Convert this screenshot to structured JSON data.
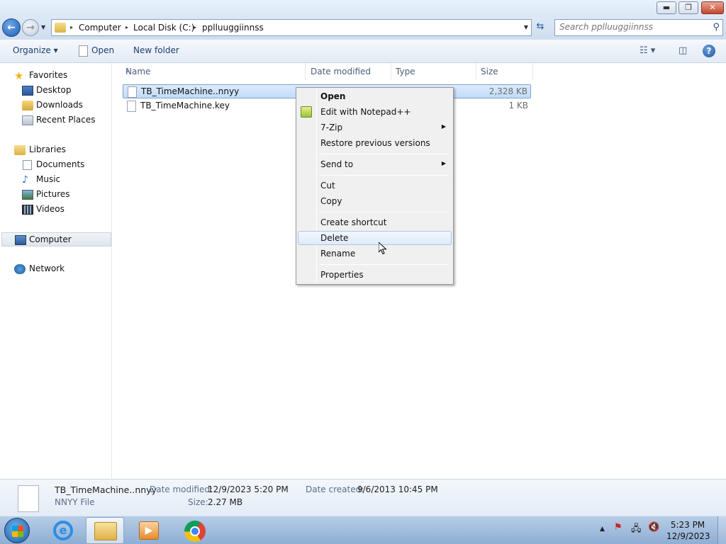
{
  "window": {
    "min_glyph": "▬",
    "max_glyph": "❐",
    "close_glyph": "✕"
  },
  "address": {
    "crumbs": [
      "Computer",
      "Local Disk (C:)",
      "pplluuggiinnss"
    ],
    "separator": "▸"
  },
  "search": {
    "placeholder": "Search pplluuggiinnss"
  },
  "toolbar": {
    "organize": "Organize ▾",
    "open": "Open",
    "new_folder": "New folder",
    "views_glyph": "☷ ▾",
    "preview_glyph": "◫",
    "help": "?"
  },
  "navpane": {
    "favorites": "Favorites",
    "desktop": "Desktop",
    "downloads": "Downloads",
    "recent": "Recent Places",
    "libraries": "Libraries",
    "documents": "Documents",
    "music": "Music",
    "pictures": "Pictures",
    "videos": "Videos",
    "computer": "Computer",
    "network": "Network"
  },
  "columns": {
    "name": "Name",
    "date_modified": "Date modified",
    "type": "Type",
    "size": "Size"
  },
  "files": [
    {
      "name": "TB_TimeMachine..nnyy",
      "size": "2,328 KB"
    },
    {
      "name": "TB_TimeMachine.key",
      "size": "1 KB"
    }
  ],
  "context_menu": {
    "open": "Open",
    "edit_npp": "Edit with Notepad++",
    "zip": "7-Zip",
    "restore": "Restore previous versions",
    "send_to": "Send to",
    "cut": "Cut",
    "copy": "Copy",
    "create_shortcut": "Create shortcut",
    "delete": "Delete",
    "rename": "Rename",
    "properties": "Properties",
    "submenu_arrow": "▶"
  },
  "details": {
    "filename": "TB_TimeMachine..nnyy",
    "filetype": "NNYY File",
    "date_modified_label": "Date modified:",
    "date_modified": "12/9/2023 5:20 PM",
    "date_created_label": "Date created:",
    "date_created": "9/6/2013 10:45 PM",
    "size_label": "Size:",
    "size": "2.27 MB"
  },
  "taskbar": {
    "ie_glyph": "e",
    "media_glyph": "▶",
    "time": "5:23 PM",
    "date": "12/9/2023",
    "tray_arrow": "▲",
    "tray_flag": "⚑",
    "tray_network": "🖧",
    "tray_volume": "🔇"
  },
  "colors": {
    "selection": "#cce4fb",
    "accent": "#1f5fb4"
  }
}
